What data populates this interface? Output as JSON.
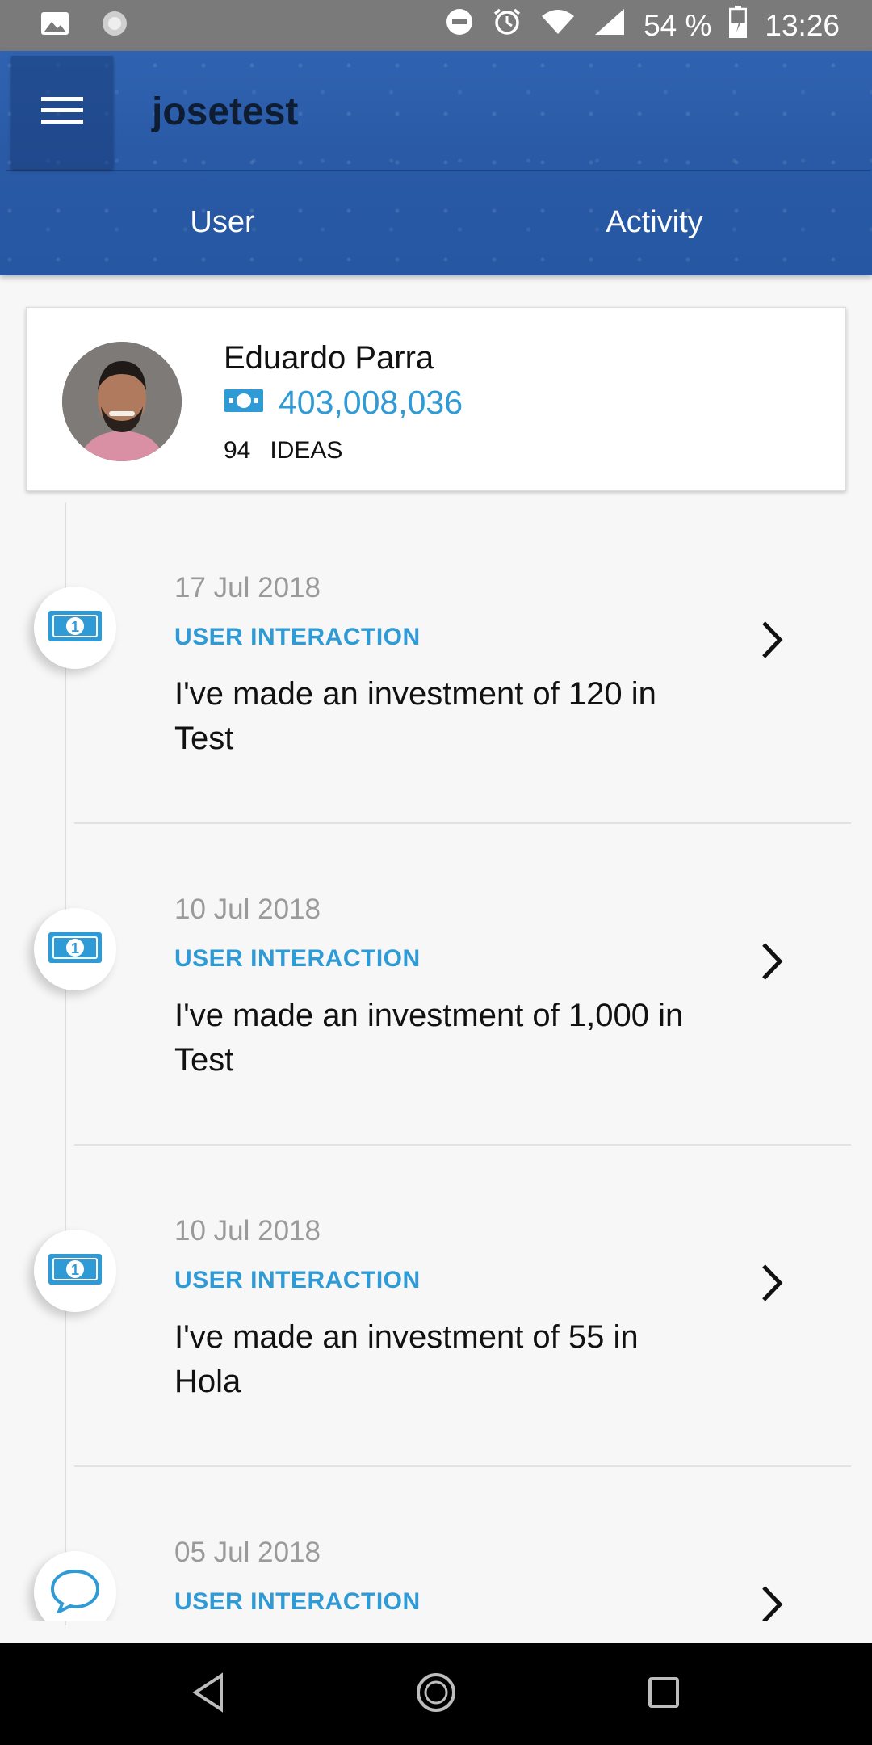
{
  "status_bar": {
    "battery": "54 %",
    "time": "13:26",
    "icons": [
      "image-icon",
      "sync-icon",
      "do-not-disturb-icon",
      "alarm-icon",
      "wifi-icon",
      "signal-icon",
      "battery-icon"
    ]
  },
  "app_bar": {
    "title": "josetest",
    "menu_icon": "hamburger-menu-icon",
    "tabs": [
      {
        "label": "User"
      },
      {
        "label": "Activity"
      }
    ]
  },
  "profile": {
    "name": "Eduardo Parra",
    "balance": "403,008,036",
    "balance_icon": "money-bill-icon",
    "ideas_count": "94",
    "ideas_label": "IDEAS"
  },
  "timeline": {
    "entries": [
      {
        "date": "17 Jul 2018",
        "type": "USER INTERACTION",
        "text": "I've made an investment of 120 in Test",
        "icon": "money-bill-icon"
      },
      {
        "date": "10 Jul 2018",
        "type": "USER INTERACTION",
        "text": "I've made an investment of 1,000 in Test",
        "icon": "money-bill-icon"
      },
      {
        "date": "10 Jul 2018",
        "type": "USER INTERACTION",
        "text": "I've made an investment of 55 in Hola",
        "icon": "money-bill-icon"
      },
      {
        "date": "05 Jul 2018",
        "type": "USER INTERACTION",
        "text": "",
        "icon": "comment-icon"
      }
    ]
  },
  "colors": {
    "accent": "#2f9bd6",
    "app_bar": "#2a5aa6",
    "status_bar": "#7a7a7a"
  },
  "nav_bar": {
    "icons": [
      "back-icon",
      "home-icon",
      "recents-icon"
    ]
  }
}
